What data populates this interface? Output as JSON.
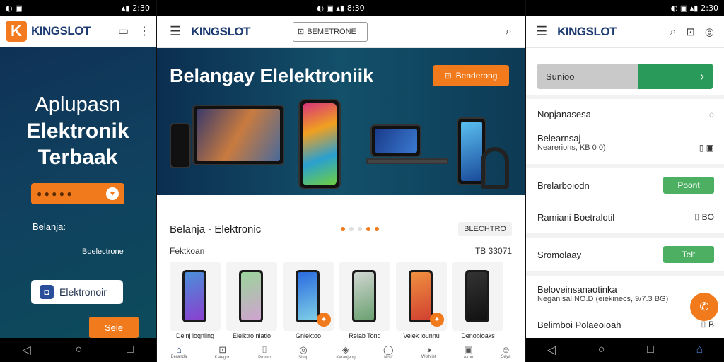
{
  "phone1": {
    "status": {
      "time": "2:30",
      "left": "◐ ▣"
    },
    "logo_k": "K",
    "logo": "KINGSLOT",
    "hero": [
      "Aplupasn",
      "Elektronik",
      "Terbaak"
    ],
    "pill_text": "● ● ● ● ●",
    "label_a": "Belanja:",
    "label_b": "Boelectrone",
    "white_btn": "Elektronoir",
    "orange_btn": "Sele"
  },
  "phone2": {
    "status": {
      "time": "8:30"
    },
    "logo": "KINGSLOT",
    "search_text": "BEMETRONE",
    "banner_title": "Belangay Elelektroniik",
    "banner_btn": "Benderong",
    "section_title": "Belanja - Elektronic",
    "section_badge": "BLECHTRO",
    "sub_left": "Fektkoan",
    "sub_right": "TB 33071",
    "products": [
      {
        "label": "Delnj loqniing",
        "fire": false,
        "screen": "linear-gradient(160deg,#4a8fd9,#8b3fcf)"
      },
      {
        "label": "Elelktro nlatio",
        "fire": false,
        "screen": "linear-gradient(160deg,#9bd49b,#cfa3cf)"
      },
      {
        "label": "Gnlektoo",
        "fire": true,
        "screen": "linear-gradient(160deg,#2a6be0,#7fcfe6)"
      },
      {
        "label": "Relab Tond",
        "fire": false,
        "screen": "linear-gradient(160deg,#d0d6d0,#6aa070)"
      },
      {
        "label": "Velek lounnu",
        "fire": true,
        "screen": "linear-gradient(160deg,#f09040,#d04030)"
      },
      {
        "label": "Denobloaks",
        "fire": false,
        "screen": "linear-gradient(160deg,#333,#111)"
      }
    ],
    "nav": [
      {
        "icon": "⌂",
        "label": "Beranda",
        "active": true
      },
      {
        "icon": "⊡",
        "label": "Kategori"
      },
      {
        "icon": "⌷",
        "label": "Promo"
      },
      {
        "icon": "◎",
        "label": "Shop"
      },
      {
        "icon": "◈",
        "label": "Keranjang"
      },
      {
        "icon": "◯",
        "label": "Notif"
      },
      {
        "icon": "◑",
        "label": "Wishlist"
      },
      {
        "icon": "▣",
        "label": "Akun"
      },
      {
        "icon": "☺",
        "label": "Saya"
      }
    ]
  },
  "phone3": {
    "status": {
      "time": "2:30"
    },
    "logo": "KINGSLOT",
    "search_label": "Sunioo",
    "rows": [
      {
        "label": "Nopjanasesa",
        "right": "◌"
      },
      {
        "label": "Belearnsaj",
        "sub": "Nearerions, KB 0 0)",
        "right": "▯ ▣"
      },
      {
        "label": "Brelarboiodn",
        "button": "Poont"
      },
      {
        "label": "Ramiani Boetralotil",
        "right": "⌷ BO"
      },
      {
        "label": "Sromolaay",
        "button": "Telt"
      },
      {
        "label": "Beloveinsanaotinka",
        "sub": "Neganisal NO.D (eiekinecs, 9/7.3 BG)"
      },
      {
        "label": "Belimboi Polaeoioah",
        "right": "⌷ B"
      }
    ]
  }
}
